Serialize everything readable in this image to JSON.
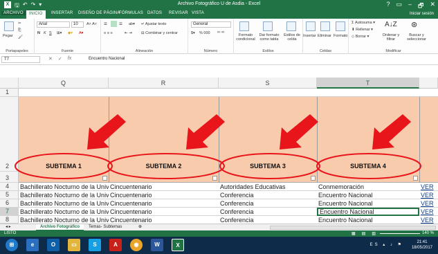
{
  "window": {
    "title": "Archivo Fotográfico U de Asdia - Excel",
    "controls": [
      "?",
      "▭",
      "–",
      "🗗",
      "✕"
    ],
    "user": "Iniciar sesión"
  },
  "ribbon_tabs": [
    "ARCHIVO",
    "INICIO",
    "INSERTAR",
    "DISEÑO DE PÁGINA",
    "FÓRMULAS",
    "DATOS",
    "REVISAR",
    "VISTA"
  ],
  "active_tab": "INICIO",
  "ribbon": {
    "clipboard": {
      "label": "Portapapeles",
      "paste": "Pegar"
    },
    "font": {
      "label": "Fuente",
      "name": "Arial",
      "size": "10",
      "bold": "N",
      "italic": "K",
      "underline": "S"
    },
    "alignment": {
      "label": "Alineación",
      "wrap": "Ajustar texto",
      "merge": "Combinar y centrar"
    },
    "number": {
      "label": "Número",
      "format": "General",
      "percent": "% 000"
    },
    "styles": {
      "label": "Estilos",
      "conditional": "Formato condicional",
      "table": "Dar formato como tabla",
      "cell": "Estilos de celda"
    },
    "cells": {
      "label": "Celdas",
      "insert": "Insertar",
      "delete": "Eliminar",
      "format": "Formato"
    },
    "editing": {
      "label": "Modificar",
      "autosum": "Autosuma",
      "fill": "Rellenar",
      "clear": "Borrar",
      "sort": "Ordenar y filtrar",
      "find": "Buscar y seleccionar"
    }
  },
  "formula_bar": {
    "namebox": "T7",
    "fx": "fx",
    "value": "Encuentro Nacional"
  },
  "columns": [
    "Q",
    "R",
    "S",
    "T"
  ],
  "active_column": "T",
  "rows": [
    "1",
    "2",
    "3",
    "4",
    "5",
    "6",
    "7",
    "8"
  ],
  "active_row": "7",
  "headers": [
    "SUBTEMA 1",
    "SUBTEMA 2",
    "SUBTEMA 3",
    "SUBTEMA 4"
  ],
  "data_rows": [
    {
      "row": "4",
      "q": "Bachillerato Nocturno de la Universidad",
      "r": "Cincuentenario",
      "s": "Autoridades Educativas",
      "t": "Conmemoración",
      "link": "VER"
    },
    {
      "row": "5",
      "q": "Bachillerato Nocturno de la Universidad",
      "r": "Cincuentenario",
      "s": "Conferencia",
      "t": "Encuentro Nacional",
      "link": "VER"
    },
    {
      "row": "6",
      "q": "Bachillerato Nocturno de la Universidad",
      "r": "Cincuentenario",
      "s": "Conferencia",
      "t": "Encuentro Nacional",
      "link": "VER"
    },
    {
      "row": "7",
      "q": "Bachillerato Nocturno de la Universidad",
      "r": "Cincuentenario",
      "s": "Conferencia",
      "t": "Encuentro Nacional",
      "link": "VER"
    },
    {
      "row": "8",
      "q": "Bachillerato Nocturno de la Universidad",
      "r": "Cincuentenario",
      "s": "Conferencia",
      "t": "Encuentro Nacional",
      "link": "VER"
    }
  ],
  "sheet_tabs": [
    "Archivo Fotográfico",
    "Temas- Subtemas"
  ],
  "active_sheet": "Archivo Fotográfico",
  "status": {
    "mode": "LISTO",
    "zoom": "140 %"
  },
  "taskbar": {
    "time": "21:41",
    "date": "18/05/2017",
    "lang": "ES",
    "apps": [
      "start",
      "ie",
      "outlook",
      "explorer",
      "skype",
      "acrobat",
      "chrome",
      "word",
      "excel"
    ]
  },
  "colors": {
    "excel_green": "#217346",
    "peach": "#f8cbad",
    "arrow_red": "#e8151b"
  }
}
